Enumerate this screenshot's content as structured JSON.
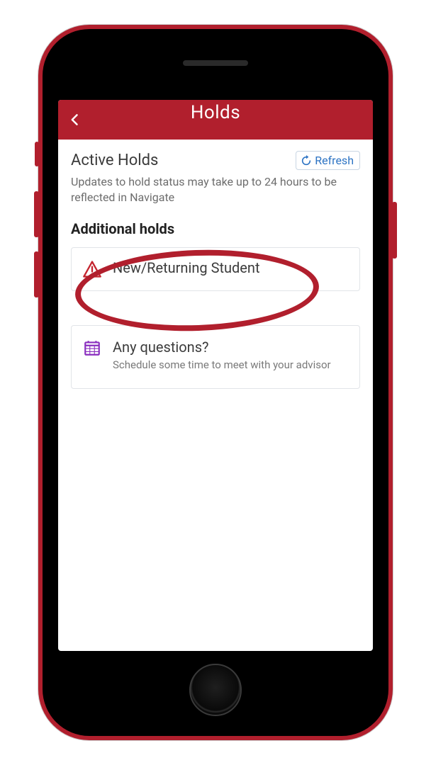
{
  "header": {
    "title": "Holds"
  },
  "active_holds": {
    "title": "Active Holds",
    "refresh_label": "Refresh",
    "helper": "Updates to hold status may take up to 24 hours to be reflected in Navigate"
  },
  "additional": {
    "heading": "Additional holds",
    "item_label": "New/Returning Student"
  },
  "questions": {
    "title": "Any questions?",
    "sub": "Schedule some time to meet with your advisor"
  }
}
